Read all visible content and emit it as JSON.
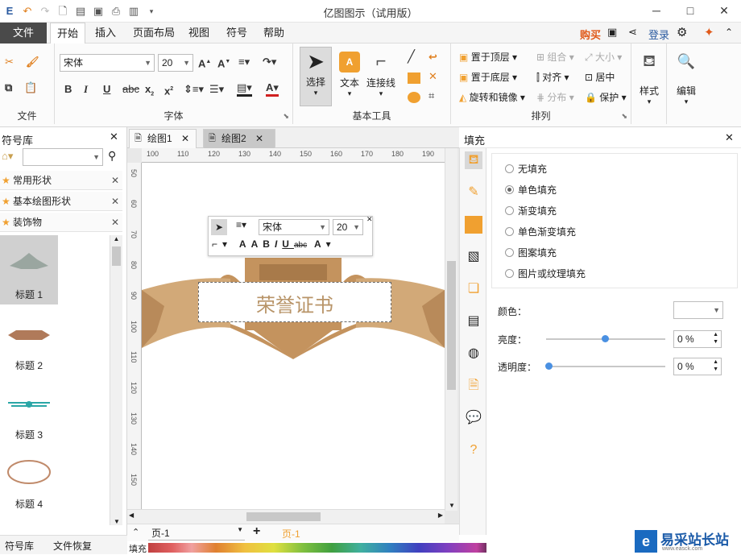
{
  "window": {
    "title": "亿图图示（试用版）",
    "minimize": "─",
    "maximize": "□",
    "close": "✕"
  },
  "menu": {
    "file": "文件",
    "tabs": [
      "开始",
      "插入",
      "页面布局",
      "视图",
      "符号",
      "帮助"
    ],
    "buy": "购买",
    "login": "登录"
  },
  "ribbon": {
    "groups": {
      "file": "文件",
      "font": "字体",
      "basic_tools": "基本工具",
      "arrange": "排列"
    },
    "font_name": "宋体",
    "font_size": "20",
    "select": "选择",
    "text": "文本",
    "connector": "连接线",
    "bring_top": "置于顶层",
    "send_bottom": "置于底层",
    "rotate_mirror": "旋转和镜像",
    "group": "组合",
    "align": "对齐",
    "distribute": "分布",
    "size": "大小",
    "center": "居中",
    "protect": "保护",
    "style": "样式",
    "edit": "编辑"
  },
  "library": {
    "title": "符号库",
    "categories": [
      "常用形状",
      "基本绘图形状",
      "装饰物"
    ],
    "items": [
      "标题 1",
      "标题 2",
      "标题 3",
      "标题 4"
    ]
  },
  "doc_tabs": [
    "绘图1",
    "绘图2"
  ],
  "ruler_h": [
    "100",
    "110",
    "120",
    "130",
    "140",
    "150",
    "160",
    "170",
    "180",
    "190"
  ],
  "ruler_v": [
    "50",
    "60",
    "70",
    "80",
    "90",
    "100",
    "110",
    "120",
    "130",
    "140",
    "150",
    "160",
    "170"
  ],
  "canvas": {
    "text": "荣誉证书",
    "float_font": "宋体",
    "float_size": "20"
  },
  "pagebar": {
    "page_select": "页-1",
    "active_page": "页-1"
  },
  "bottom_tabs": [
    "符号库",
    "文件恢复"
  ],
  "palette_label": "填充",
  "fill_panel": {
    "title": "填充",
    "options": [
      "无填充",
      "单色填充",
      "渐变填充",
      "单色渐变填充",
      "图案填充",
      "图片或纹理填充"
    ],
    "selected": 1,
    "color_label": "颜色：",
    "brightness_label": "亮度：",
    "brightness_value": "0 %",
    "transparency_label": "透明度：",
    "transparency_value": "0 %"
  },
  "watermark": {
    "brand": "易采站长站",
    "sub": "www.easck.com"
  },
  "colors": {
    "accent": "#f0a030",
    "file_tab": "#4a4a4a",
    "banner": "#d2a978",
    "banner_dark": "#c4935e",
    "text_tan": "#b89468"
  }
}
